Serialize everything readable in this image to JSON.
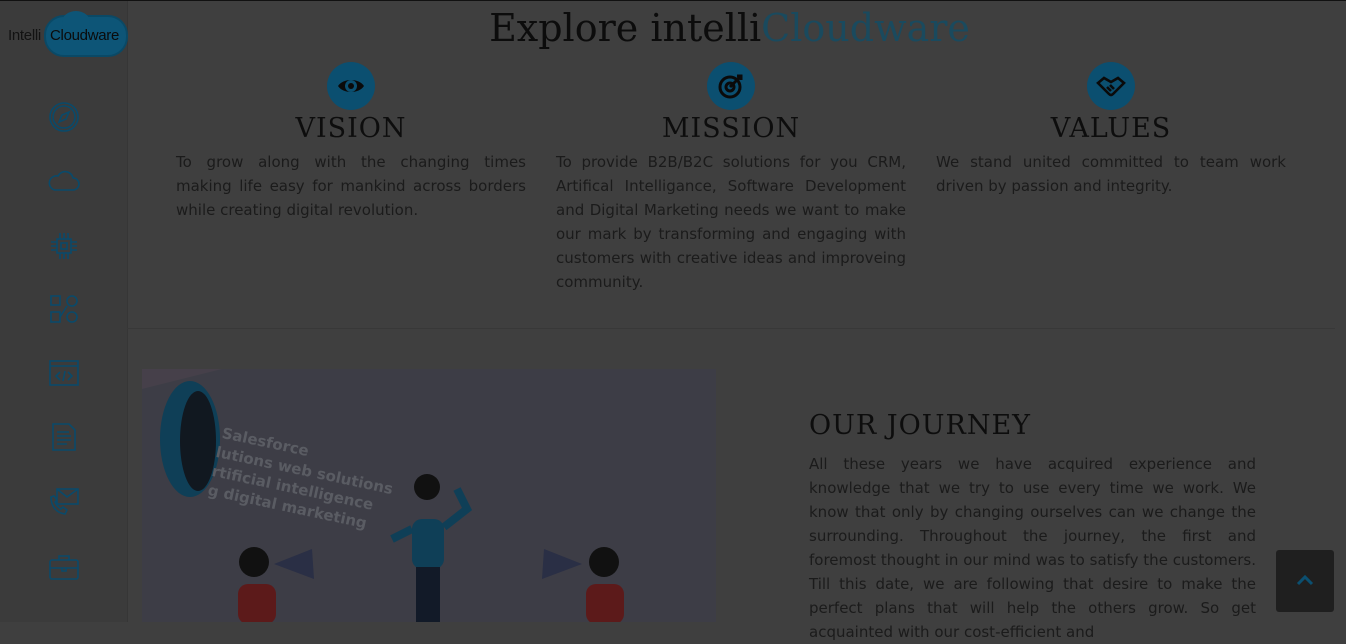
{
  "logo": {
    "text_left": "Intelli",
    "text_right": "Cloudware"
  },
  "sidebar": {
    "icons": [
      "compass-icon",
      "cloud-icon",
      "chip-icon",
      "analytics-icon",
      "code-window-icon",
      "document-icon",
      "mail-phone-icon",
      "briefcase-icon"
    ]
  },
  "header": {
    "title_main": "Explore intelli",
    "title_accent": "Cloudware"
  },
  "columns": [
    {
      "title": "VISION",
      "icon": "eye-icon",
      "text": "To grow along with the changing times making life easy for mankind across borders while creating digital revolution."
    },
    {
      "title": "MISSION",
      "icon": "target-icon",
      "text": "To provide B2B/B2C solutions for you CRM, Artifical Intelligance, Software Development and Digital Marketing needs we want to make our mark by transforming and engaging with customers with creative ideas and improveing community."
    },
    {
      "title": "VALUES",
      "icon": "handshake-icon",
      "text": "We stand united committed to team work driven by passion and integrity."
    }
  ],
  "illustration": {
    "lines": [
      "Salesforce",
      "lutions web solutions",
      "rtificial intelligence",
      "g digital marketing"
    ]
  },
  "journey": {
    "title": "OUR JOURNEY",
    "text": "All these years we have acquired experience and knowledge that we try to use every time we work. We know that only by changing ourselves can we change the surrounding. Throughout the journey, the first and foremost thought in our mind was to satisfy the customers. Till this date, we are following that desire to make the perfect plans that will help the others grow. So get acquainted with our cost-efficient and"
  },
  "colors": {
    "accent": "#0b4f70",
    "overlay": "#3f3f3f"
  }
}
